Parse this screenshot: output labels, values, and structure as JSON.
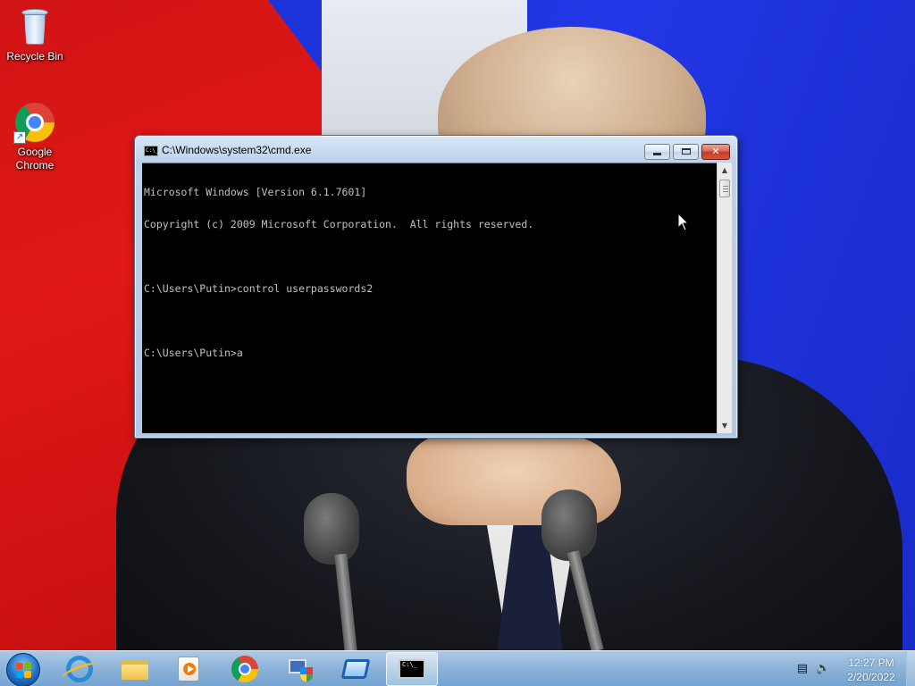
{
  "desktop": {
    "icons": [
      {
        "label": "Recycle Bin",
        "icon": "recycle-bin-icon"
      },
      {
        "label": "Google\nChrome",
        "icon": "chrome-icon"
      }
    ]
  },
  "cmd_window": {
    "title": "C:\\Windows\\system32\\cmd.exe",
    "buttons": {
      "minimize": "minimize",
      "maximize": "maximize",
      "close": "✕"
    },
    "lines": [
      "Microsoft Windows [Version 6.1.7601]",
      "Copyright (c) 2009 Microsoft Corporation.  All rights reserved.",
      "",
      "C:\\Users\\Putin>control userpasswords2",
      "",
      "C:\\Users\\Putin>a"
    ],
    "title_icon_text": "C:\\_"
  },
  "taskbar": {
    "start_icon": "windows-start-orb",
    "pinned": [
      {
        "name": "internet-explorer",
        "icon": "ie-icon"
      },
      {
        "name": "windows-explorer",
        "icon": "folder-icon"
      },
      {
        "name": "windows-media-player",
        "icon": "media-player-icon"
      },
      {
        "name": "google-chrome",
        "icon": "chrome-icon"
      },
      {
        "name": "network-and-sharing",
        "icon": "network-shield-icon"
      },
      {
        "name": "remote-desktop",
        "icon": "remote-desktop-icon"
      },
      {
        "name": "command-prompt",
        "icon": "cmd-icon",
        "active": true
      }
    ],
    "cmd_glyph_text": "C:\\_",
    "tray": {
      "network_icon": "▤",
      "volume_icon": "🔈",
      "time": "12:27 PM",
      "date": "2/20/2022"
    }
  },
  "colors": {
    "flag_red": "#d21414",
    "flag_blue": "#1b2fd0",
    "console_bg": "#000000",
    "console_text": "#c0c0c0",
    "close_button": "#c43b22"
  }
}
